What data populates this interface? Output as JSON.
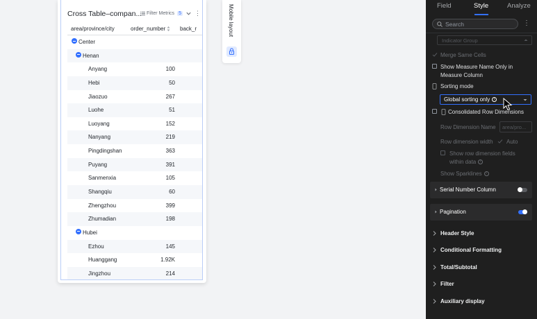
{
  "card": {
    "title": "Cross Table–compan...",
    "filter_metrics_label": "Filter Metrics",
    "filter_metrics_count": "5",
    "columns": [
      "area/province/city",
      "order_number",
      "back_r"
    ],
    "rows": [
      {
        "type": "group",
        "label": "Center",
        "value": ""
      },
      {
        "type": "subgroup",
        "label": "Henan",
        "value": ""
      },
      {
        "type": "leaf",
        "label": "Anyang",
        "value": "100"
      },
      {
        "type": "leaf",
        "label": "Hebi",
        "value": "50"
      },
      {
        "type": "leaf",
        "label": "Jiaozuo",
        "value": "267"
      },
      {
        "type": "leaf",
        "label": "Luohe",
        "value": "51"
      },
      {
        "type": "leaf",
        "label": "Luoyang",
        "value": "152"
      },
      {
        "type": "leaf",
        "label": "Nanyang",
        "value": "219"
      },
      {
        "type": "leaf",
        "label": "Pingdingshan",
        "value": "363"
      },
      {
        "type": "leaf",
        "label": "Puyang",
        "value": "391"
      },
      {
        "type": "leaf",
        "label": "Sanmenxia",
        "value": "105"
      },
      {
        "type": "leaf",
        "label": "Shangqiu",
        "value": "60"
      },
      {
        "type": "leaf",
        "label": "Zhengzhou",
        "value": "399"
      },
      {
        "type": "leaf",
        "label": "Zhumadian",
        "value": "198"
      },
      {
        "type": "subgroup",
        "label": "Hubei",
        "value": ""
      },
      {
        "type": "leaf",
        "label": "Ezhou",
        "value": "145"
      },
      {
        "type": "leaf",
        "label": "Huanggang",
        "value": "1.92K"
      },
      {
        "type": "leaf",
        "label": "Jingzhou",
        "value": "214"
      }
    ]
  },
  "mobile": {
    "label": "Mobile layout"
  },
  "panel": {
    "tabs": [
      "Field",
      "Style",
      "Analyze"
    ],
    "active_tab": "Style",
    "search_placeholder": "Search",
    "indicator_group": "Indicator Group",
    "merge_same_cells": "Merge Same Cells",
    "show_measure_name": "Show Measure Name Only in",
    "show_measure_name_2": "Measure Column",
    "sorting_mode": "Sorting mode",
    "sorting_value": "Global sorting only",
    "consolidated_row_dimensions": "Consolidated Row Dimensions",
    "row_dimension_name": "Row Dimension Name",
    "row_dimension_name_value": "area/pro...",
    "row_dimension_width": "Row dimension width",
    "auto": "Auto",
    "show_row_dimension_fields": "Show row dimension fields",
    "within_data": "within data",
    "show_sparklines": "Show Sparklines",
    "serial_number_column": "Serial Number Column",
    "serial_number_on": false,
    "pagination": "Pagination",
    "pagination_on": true,
    "sections": [
      "Header Style",
      "Conditional Formatting",
      "Total/Subtotal",
      "Filter",
      "Auxiliary display"
    ]
  },
  "colors": {
    "accent": "#3370ff",
    "panel_bg": "#1f1f1f",
    "canvas_bg": "#f2f3f5"
  }
}
